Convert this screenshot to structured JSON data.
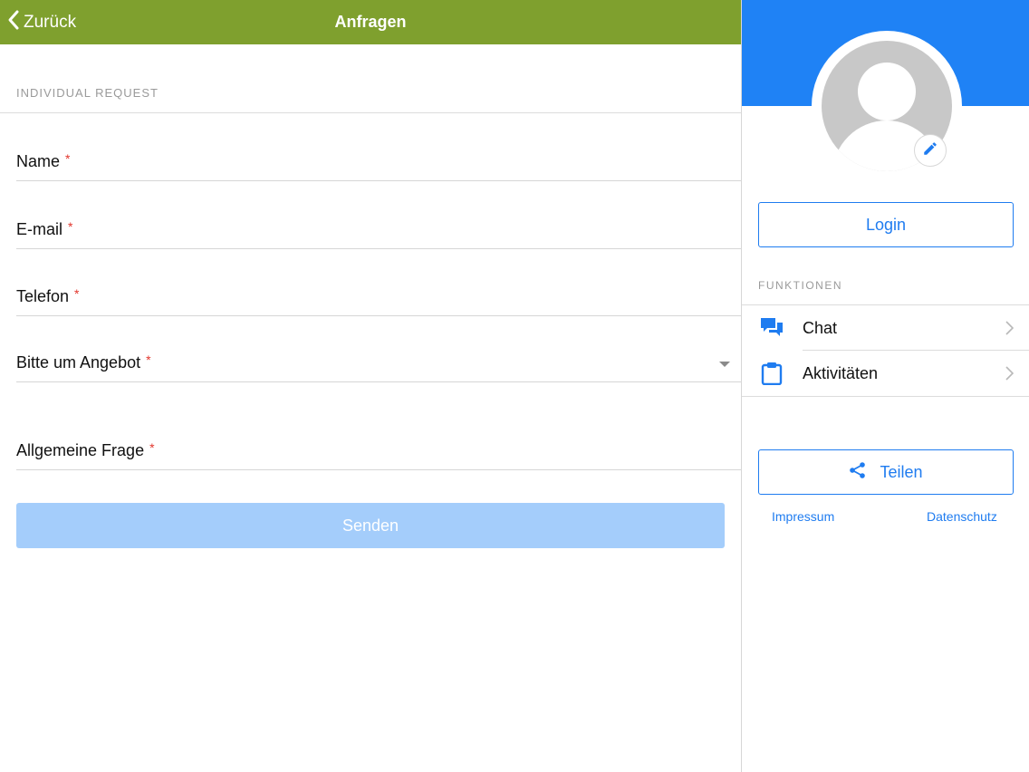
{
  "colors": {
    "nav_bg": "#7fa02e",
    "accent_blue": "#1f82f5",
    "send_disabled": "#a4cdfb",
    "required_star": "#e2362d"
  },
  "nav": {
    "back_label": "Zurück",
    "back_icon": "chevron-left-icon",
    "title": "Anfragen"
  },
  "form": {
    "section_title": "INDIVIDUAL REQUEST",
    "required_marker": "*",
    "fields": [
      {
        "label": "Name",
        "type": "text",
        "required": true
      },
      {
        "label": "E-mail",
        "type": "text",
        "required": true
      },
      {
        "label": "Telefon",
        "type": "text",
        "required": true
      },
      {
        "label": "Bitte um Angebot",
        "type": "select",
        "required": true
      },
      {
        "label": "Allgemeine Frage",
        "type": "text",
        "required": true
      }
    ],
    "submit_label": "Senden"
  },
  "sidebar": {
    "avatar_icon": "user-placeholder-icon",
    "edit_icon": "pencil-icon",
    "login_label": "Login",
    "functions_title": "FUNKTIONEN",
    "items": [
      {
        "label": "Chat",
        "icon": "chat-bubbles-icon"
      },
      {
        "label": "Aktivitäten",
        "icon": "clipboard-icon"
      }
    ],
    "share_label": "Teilen",
    "share_icon": "share-icon",
    "impressum_label": "Impressum",
    "datenschutz_label": "Datenschutz"
  }
}
